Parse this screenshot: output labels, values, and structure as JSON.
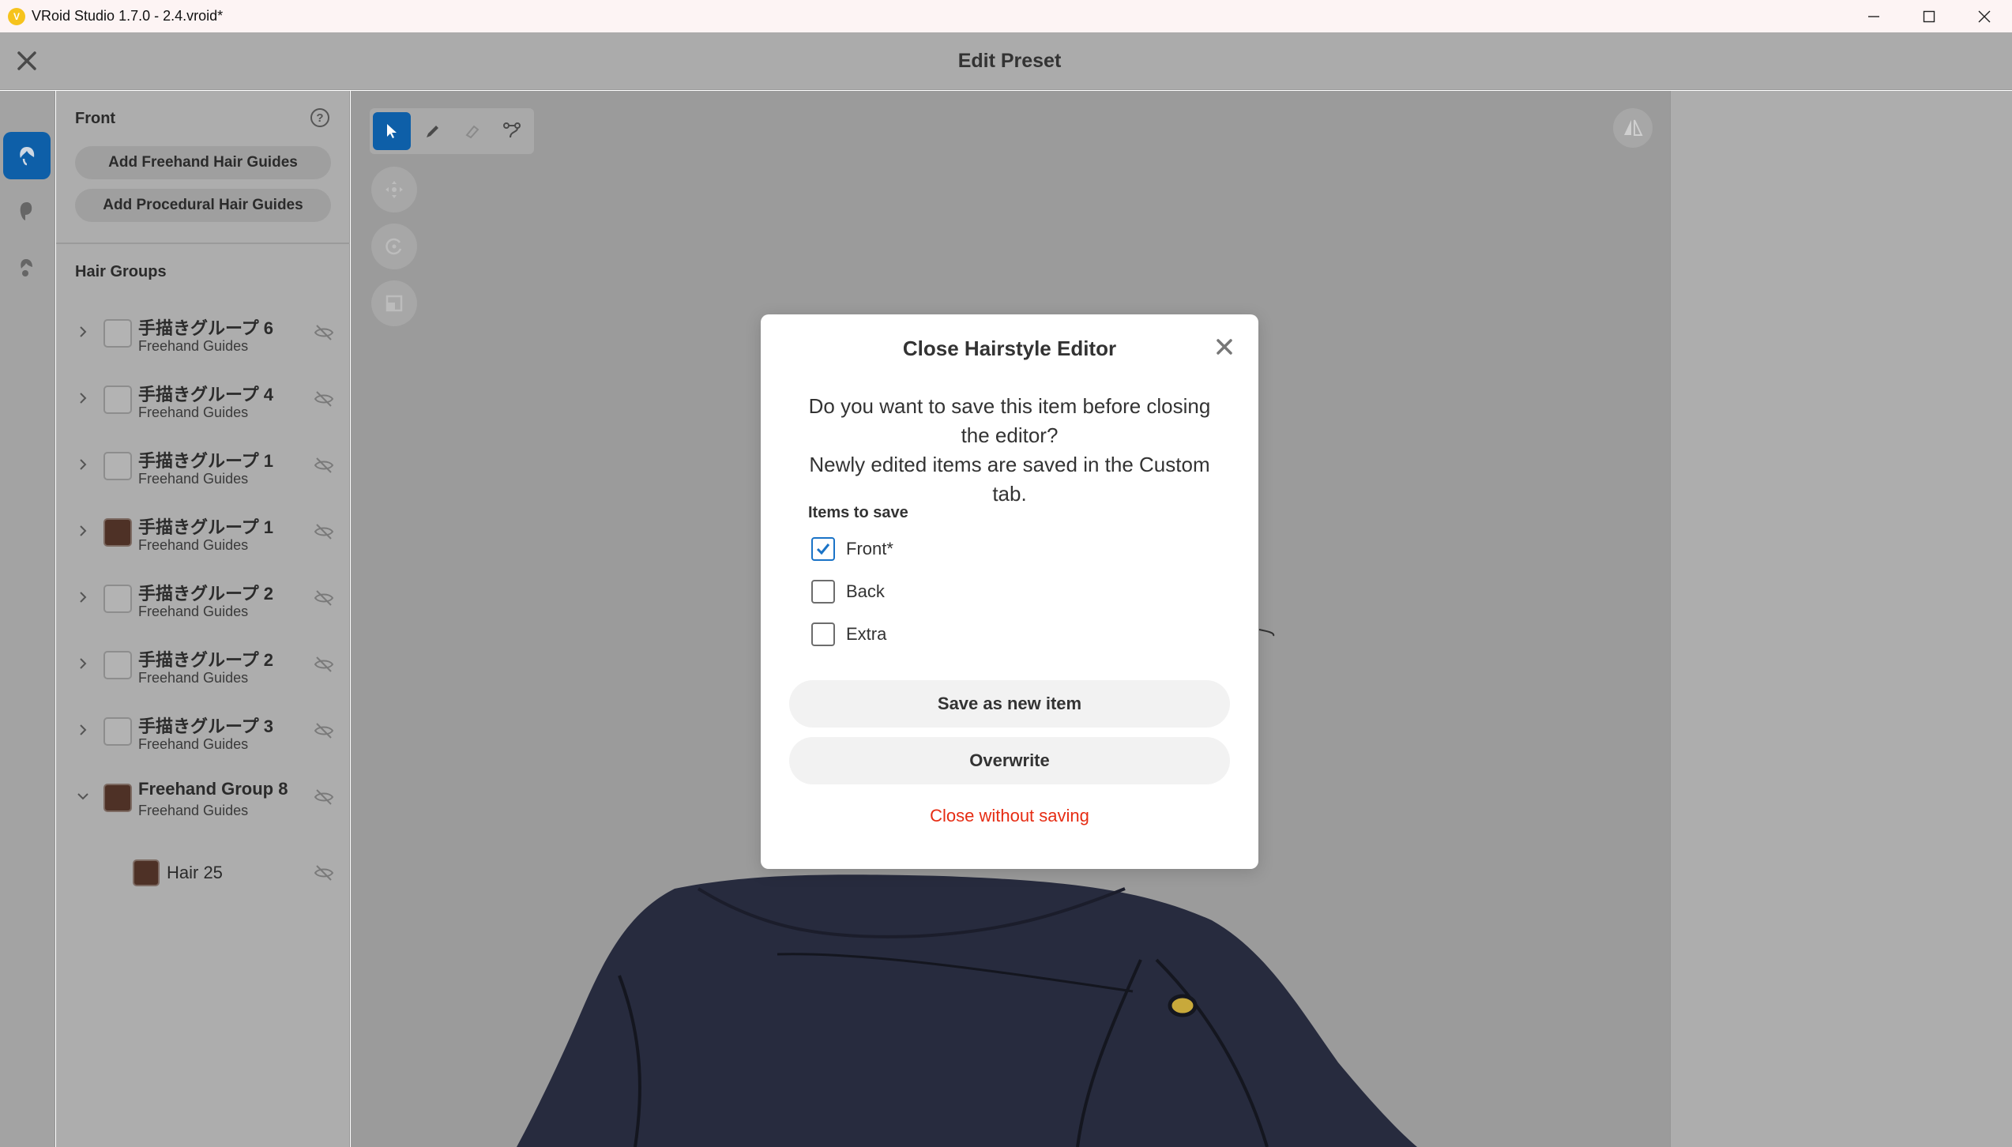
{
  "window": {
    "title": "VRoid Studio 1.7.0 - 2.4.vroid*"
  },
  "header": {
    "title": "Edit Preset"
  },
  "side_panel": {
    "section_title": "Front",
    "buttons": {
      "freehand": "Add Freehand Hair Guides",
      "procedural": "Add Procedural Hair Guides"
    },
    "groups_title": "Hair Groups",
    "groups": [
      {
        "name": "手描きグループ 6",
        "sub": "Freehand Guides",
        "filled": false,
        "expanded": false
      },
      {
        "name": "手描きグループ 4",
        "sub": "Freehand Guides",
        "filled": false,
        "expanded": false
      },
      {
        "name": "手描きグループ 1",
        "sub": "Freehand Guides",
        "filled": false,
        "expanded": false
      },
      {
        "name": "手描きグループ 1",
        "sub": "Freehand Guides",
        "filled": true,
        "expanded": false
      },
      {
        "name": "手描きグループ 2",
        "sub": "Freehand Guides",
        "filled": false,
        "expanded": false
      },
      {
        "name": "手描きグループ 2",
        "sub": "Freehand Guides",
        "filled": false,
        "expanded": false
      },
      {
        "name": "手描きグループ 3",
        "sub": "Freehand Guides",
        "filled": false,
        "expanded": false
      },
      {
        "name": "Freehand Group 8",
        "sub": "Freehand Guides",
        "filled": true,
        "expanded": true
      }
    ],
    "child_item": "Hair 25"
  },
  "colors": {
    "accent": "#0e5fa8",
    "hair_swatch": "#4e3126",
    "danger": "#e62c13"
  },
  "dialog": {
    "title": "Close Hairstyle Editor",
    "message_line1": "Do you want to save this item before closing the editor?",
    "message_line2": "Newly edited items are saved in the Custom tab.",
    "items_label": "Items to save",
    "items": [
      {
        "label": "Front*",
        "checked": true
      },
      {
        "label": "Back",
        "checked": false
      },
      {
        "label": "Extra",
        "checked": false
      }
    ],
    "save_new": "Save as new item",
    "overwrite": "Overwrite",
    "close_without_saving": "Close without saving"
  }
}
